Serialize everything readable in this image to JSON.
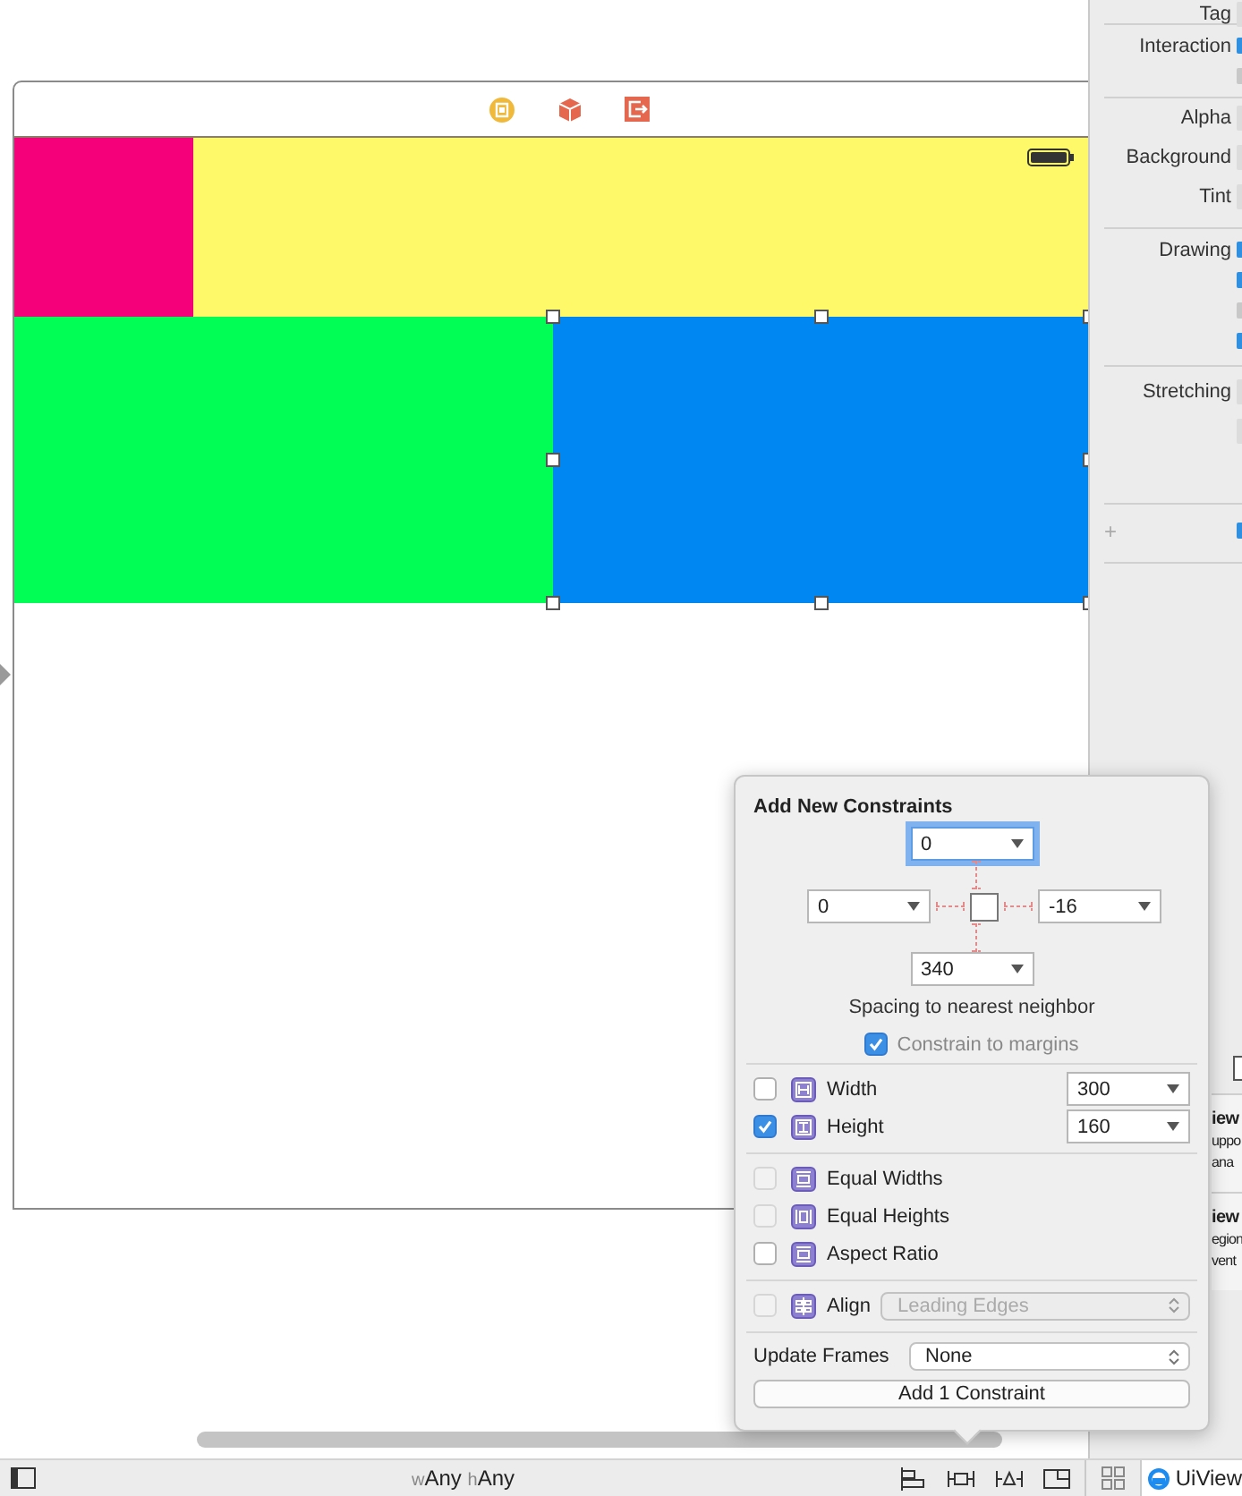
{
  "scene": {
    "views": [
      {
        "color": "#f5007a",
        "selected": false
      },
      {
        "color": "#fef969",
        "selected": false
      },
      {
        "color": "#00fe55",
        "selected": false
      },
      {
        "color": "#0187f2",
        "selected": true
      }
    ]
  },
  "inspector": {
    "sections": [
      {
        "rows": [
          {
            "label": "Tag",
            "kind": "field"
          }
        ]
      },
      {
        "rows": [
          {
            "label": "Interaction",
            "kind": "checkbox",
            "checked": true
          },
          {
            "kind": "checkbox",
            "checked": false
          }
        ]
      },
      {
        "rows": [
          {
            "label": "Alpha",
            "kind": "field"
          },
          {
            "label": "Background",
            "kind": "field"
          },
          {
            "label": "Tint",
            "kind": "field"
          }
        ]
      },
      {
        "rows": [
          {
            "label": "Drawing",
            "kind": "checkbox",
            "checked": true
          },
          {
            "kind": "checkbox",
            "checked": true
          },
          {
            "kind": "checkbox",
            "checked": false
          },
          {
            "kind": "checkbox",
            "checked": true
          }
        ]
      },
      {
        "rows": [
          {
            "label": "Stretching",
            "kind": "field"
          },
          {
            "kind": "field"
          }
        ]
      },
      {
        "rows": [
          {
            "label": "+",
            "kind": "checkbox",
            "checked": true
          }
        ]
      }
    ],
    "library_toggle": {
      "checked": false
    },
    "library": [
      {
        "lines": [
          "iew",
          "uppo",
          "ana"
        ]
      },
      {
        "lines": [
          "iew",
          "egion",
          "vent"
        ]
      }
    ]
  },
  "constraints_popover": {
    "title": "Add New Constraints",
    "spacing_fields": [
      {
        "value": "0",
        "focused": true
      },
      {
        "value": "0",
        "focused": false
      },
      {
        "value": "-16",
        "focused": false
      },
      {
        "value": "340",
        "focused": false
      }
    ],
    "spacing_label": "Spacing to nearest neighbor",
    "constrain_to_margins": {
      "label": "Constrain to margins",
      "checked": true
    },
    "size_rows": [
      {
        "label": "Width",
        "checked": false,
        "value": "300"
      },
      {
        "label": "Height",
        "checked": true,
        "value": "160"
      }
    ],
    "relation_rows": [
      {
        "label": "Equal Widths",
        "checked": false,
        "disabled": true
      },
      {
        "label": "Equal Heights",
        "checked": false,
        "disabled": true
      },
      {
        "label": "Aspect Ratio",
        "checked": false,
        "disabled": false
      }
    ],
    "align": {
      "label": "Align",
      "checked": false,
      "disabled": true,
      "value": "Leading Edges"
    },
    "update_frames": {
      "label": "Update Frames",
      "value": "None"
    },
    "add_button": "Add 1 Constraint"
  },
  "bottom_bar": {
    "size_class": [
      {
        "prefix": "w",
        "value": "Any"
      },
      {
        "prefix": "h",
        "value": "Any"
      }
    ],
    "outline_item": "UiView"
  }
}
